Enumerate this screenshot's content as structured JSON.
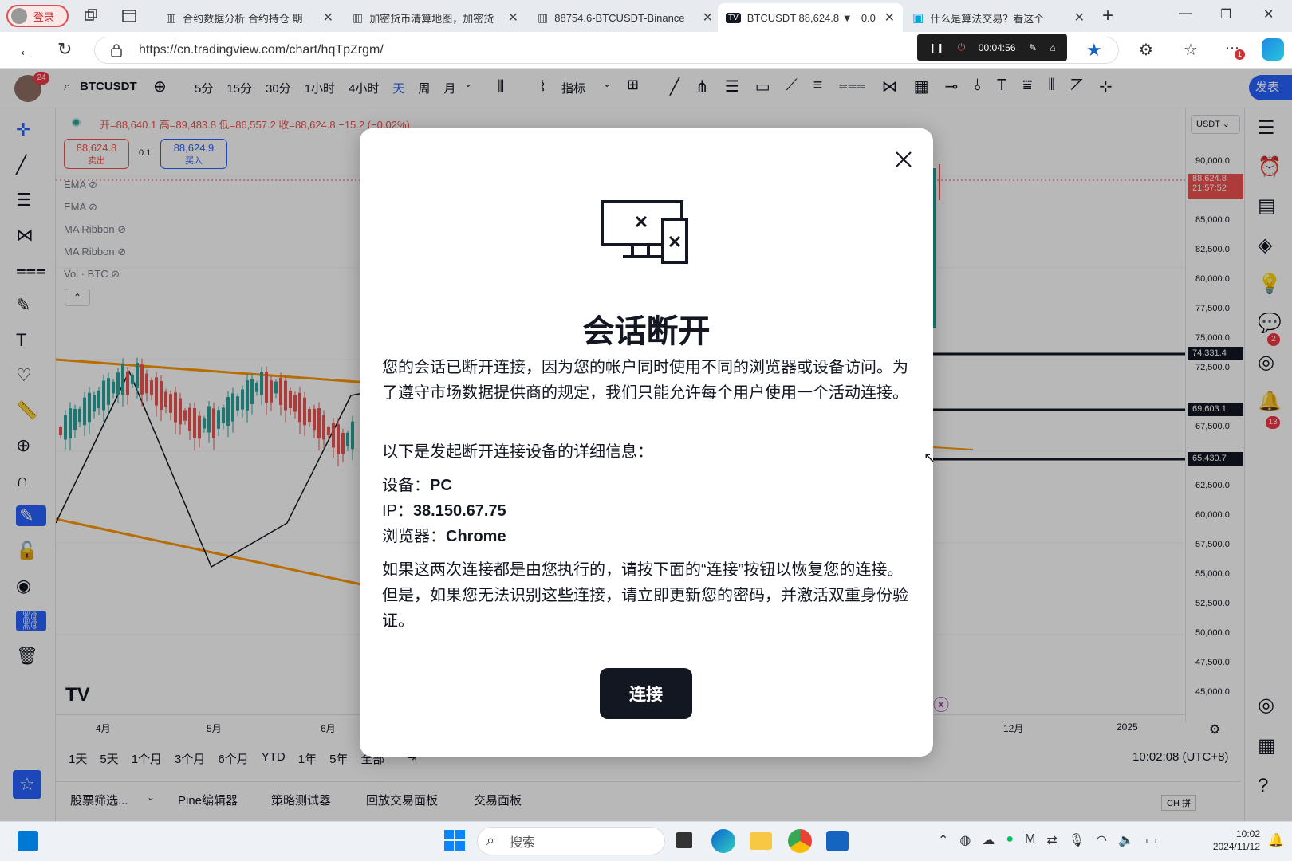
{
  "browser": {
    "profile_label": "登录",
    "tabs": [
      {
        "title": "合约数据分析 合约持仓 期"
      },
      {
        "title": "加密货币清算地图，加密货"
      },
      {
        "title": "88754.6-BTCUSDT-Binance"
      },
      {
        "title": "BTCUSDT 88,624.8 ▼ −0.0"
      },
      {
        "title": "什么是算法交易？看这个"
      }
    ],
    "new_tab": "+",
    "url": "https://cn.tradingview.com/chart/hqTpZrgm/",
    "recorder_time": "00:04:56",
    "extension_badge": "1"
  },
  "tradingview": {
    "avatar_badge": "24",
    "symbol": "BTCUSDT",
    "intervals": [
      "5分",
      "15分",
      "30分",
      "1小时",
      "4小时",
      "天",
      "周",
      "月"
    ],
    "active_interval": "天",
    "indicators_label": "指标",
    "publish_label": "发表",
    "ohlc": "开=88,640.1 高=89,483.8 低=86,557.2 收=88,624.8 −15.2 (−0.02%)",
    "sell_price": "88,624.8",
    "sell_label": "卖出",
    "spread": "0.1",
    "buy_price": "88,624.9",
    "buy_label": "买入",
    "indicators": [
      "EMA",
      "EMA",
      "MA Ribbon",
      "MA Ribbon",
      "Vol · BTC"
    ],
    "currency": "USDT",
    "price_ticks": [
      "90,000.0",
      "85,000.0",
      "82,500.0",
      "80,000.0",
      "77,500.0",
      "75,000.0",
      "72,500.0",
      "67,500.0",
      "62,500.0",
      "60,000.0",
      "57,500.0",
      "55,000.0",
      "52,500.0",
      "50,000.0",
      "47,500.0",
      "45,000.0"
    ],
    "last_price_label": "88,624.8",
    "countdown": "21:57:52",
    "level_labels": [
      "74,331.4",
      "69,603.1",
      "65,430.7"
    ],
    "time_ticks": [
      "4月",
      "5月",
      "6月",
      "12月",
      "2025"
    ],
    "ranges": [
      "1天",
      "5天",
      "1个月",
      "3个月",
      "6个月",
      "YTD",
      "1年",
      "5年",
      "全部"
    ],
    "clock": "10:02:08 (UTC+8)",
    "bottom_tabs": [
      "股票筛选...",
      "Pine编辑器",
      "策略测试器",
      "回放交易面板",
      "交易面板"
    ],
    "right_badges": [
      "2",
      "13"
    ],
    "ime": "CH"
  },
  "modal": {
    "title": "会话断开",
    "p1": "您的会话已断开连接，因为您的帐户同时使用不同的浏览器或设备访问。为了遵守市场数据提供商的规定，我们只能允许每个用户使用一个活动连接。",
    "p2": "以下是发起断开连接设备的详细信息：",
    "device_label": "设备：",
    "device_value": "PC",
    "ip_label": "IP：",
    "ip_value": "38.150.67.75",
    "browser_label": "浏览器：",
    "browser_value": "Chrome",
    "p3": "如果这两次连接都是由您执行的，请按下面的“连接”按钮以恢复您的连接。但是，如果您无法识别这些连接，请立即更新您的密码，并激活双重身份验证。",
    "connect_label": "连接"
  },
  "taskbar": {
    "search_placeholder": "搜索",
    "time": "10:02",
    "date": "2024/11/12"
  }
}
